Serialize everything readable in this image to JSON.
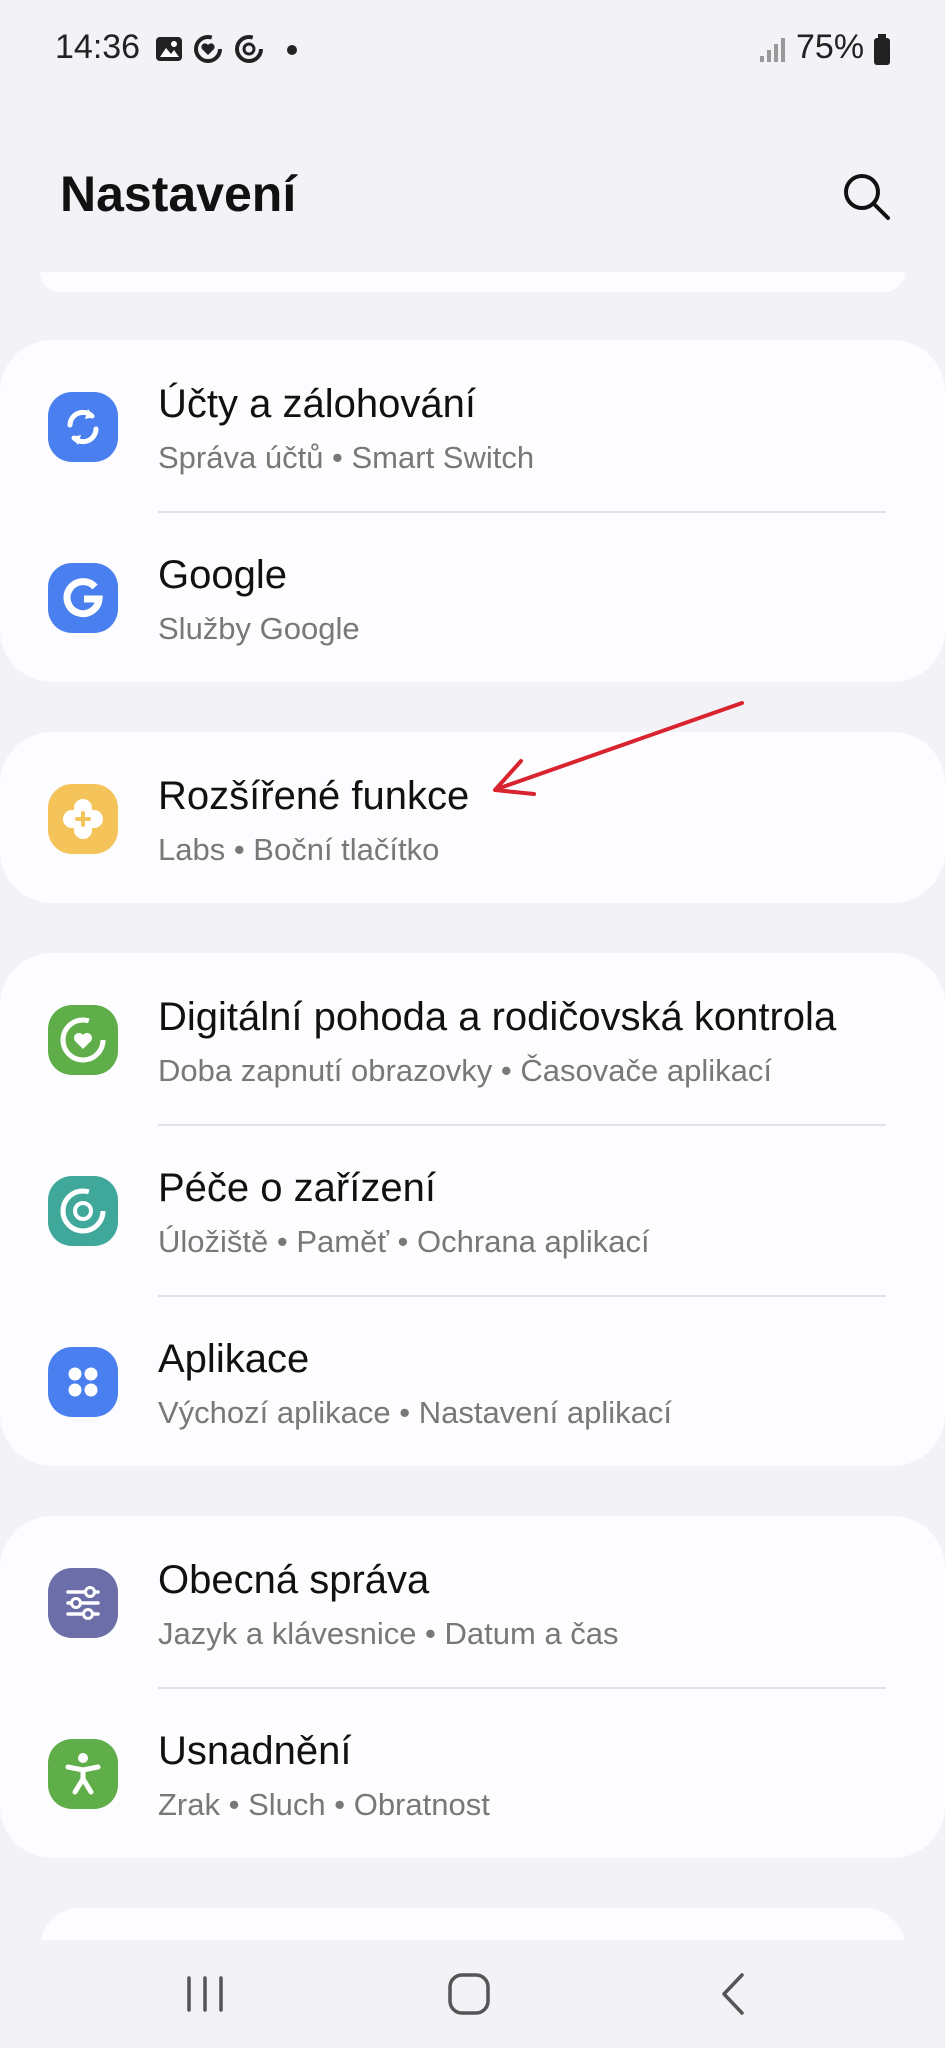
{
  "status_bar": {
    "time": "14:36",
    "battery": "75%",
    "icons": [
      "gallery-icon",
      "digital-wellbeing-icon",
      "device-care-icon",
      "notification-dot",
      "signal-icon",
      "battery-icon"
    ]
  },
  "header": {
    "title": "Nastavení",
    "search_icon": "search-icon"
  },
  "groups": [
    {
      "items": [
        {
          "title": "Účty a zálohování",
          "subtitle": "Správa účtů • Smart Switch",
          "icon": "sync-icon",
          "color": "#4a7ff0"
        },
        {
          "title": "Google",
          "subtitle": "Služby Google",
          "icon": "google-icon",
          "color": "#4a7ff0"
        }
      ]
    },
    {
      "items": [
        {
          "title": "Rozšířené funkce",
          "subtitle": "Labs • Boční tlačítko",
          "icon": "advanced-features-icon",
          "color": "#f4c35a"
        }
      ]
    },
    {
      "items": [
        {
          "title": "Digitální pohoda a rodičovská kontrola",
          "subtitle": "Doba zapnutí obrazovky • Časovače aplikací",
          "icon": "digital-wellbeing-icon",
          "color": "#5fae4a"
        },
        {
          "title": "Péče o zařízení",
          "subtitle": "Úložiště • Paměť • Ochrana aplikací",
          "icon": "device-care-icon",
          "color": "#3fa89a"
        },
        {
          "title": "Aplikace",
          "subtitle": "Výchozí aplikace • Nastavení aplikací",
          "icon": "apps-icon",
          "color": "#4a7ff0"
        }
      ]
    },
    {
      "items": [
        {
          "title": "Obecná správa",
          "subtitle": "Jazyk a klávesnice • Datum a čas",
          "icon": "general-management-icon",
          "color": "#6b6ea8"
        },
        {
          "title": "Usnadnění",
          "subtitle": "Zrak • Sluch • Obratnost",
          "icon": "accessibility-icon",
          "color": "#5fae4a"
        }
      ]
    }
  ],
  "annotation": {
    "color": "#d9232e",
    "points_to": "Rozšířené funkce"
  },
  "nav_bar": {
    "buttons": [
      "recents-button",
      "home-button",
      "back-button"
    ]
  }
}
